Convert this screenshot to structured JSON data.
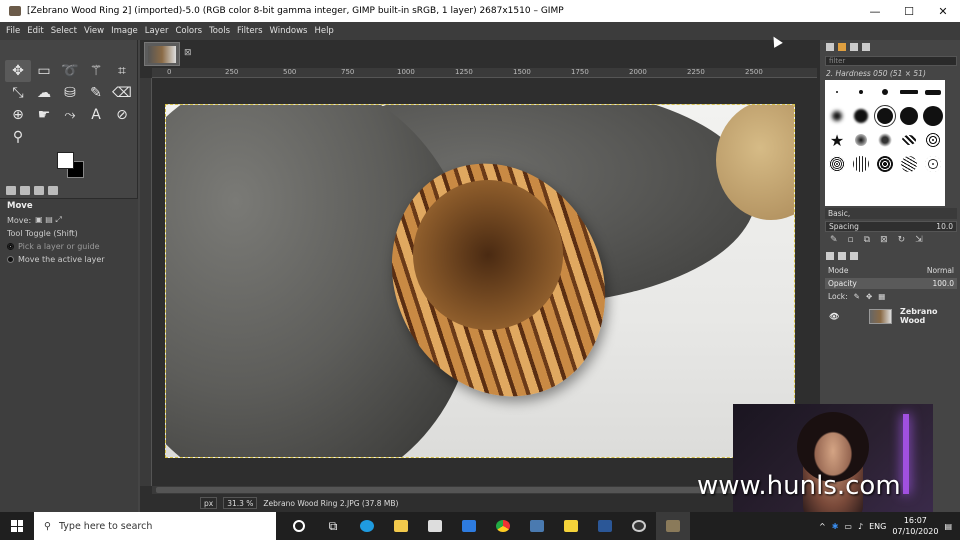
{
  "window": {
    "title": "[Zebrano Wood Ring 2] (imported)-5.0 (RGB color 8-bit gamma integer, GIMP built-in sRGB, 1 layer) 2687x1510 – GIMP",
    "minimize": "—",
    "maximize": "☐",
    "close": "✕"
  },
  "menu": [
    "File",
    "Edit",
    "Select",
    "View",
    "Image",
    "Layer",
    "Colors",
    "Tools",
    "Filters",
    "Windows",
    "Help"
  ],
  "ruler_ticks": [
    "0",
    "250",
    "500",
    "750",
    "1000",
    "1250",
    "1500",
    "1750",
    "2000",
    "2250",
    "2500"
  ],
  "tool_options": {
    "title": "Move",
    "move_label": "Move:",
    "toggle": "Tool Toggle  (Shift)",
    "opt1": "Pick a layer or guide",
    "opt2": "Move the active layer"
  },
  "status": {
    "unit": "px",
    "zoom": "31.3 %",
    "file": "Zebrano Wood Ring 2.JPG (37.8 MB)"
  },
  "brushes": {
    "filter": "filter",
    "current": "2. Hardness 050 (51 × 51)",
    "preset": "Basic,",
    "spacing_label": "Spacing",
    "spacing_value": "10.0"
  },
  "layers": {
    "mode_label": "Mode",
    "mode_value": "Normal",
    "opacity_label": "Opacity",
    "opacity_value": "100.0",
    "lock_label": "Lock:",
    "layer_name": "Zebrano Wood"
  },
  "watermark": "www.hunls.com",
  "taskbar": {
    "search_placeholder": "Type here to search",
    "lang": "ENG",
    "time": "16:07",
    "date": "07/10/2020"
  },
  "icons": {
    "move": "move-icon",
    "rect": "rect-select-icon",
    "lasso": "lasso-icon",
    "wand": "fuzzy-select-icon",
    "crop": "crop-icon"
  }
}
